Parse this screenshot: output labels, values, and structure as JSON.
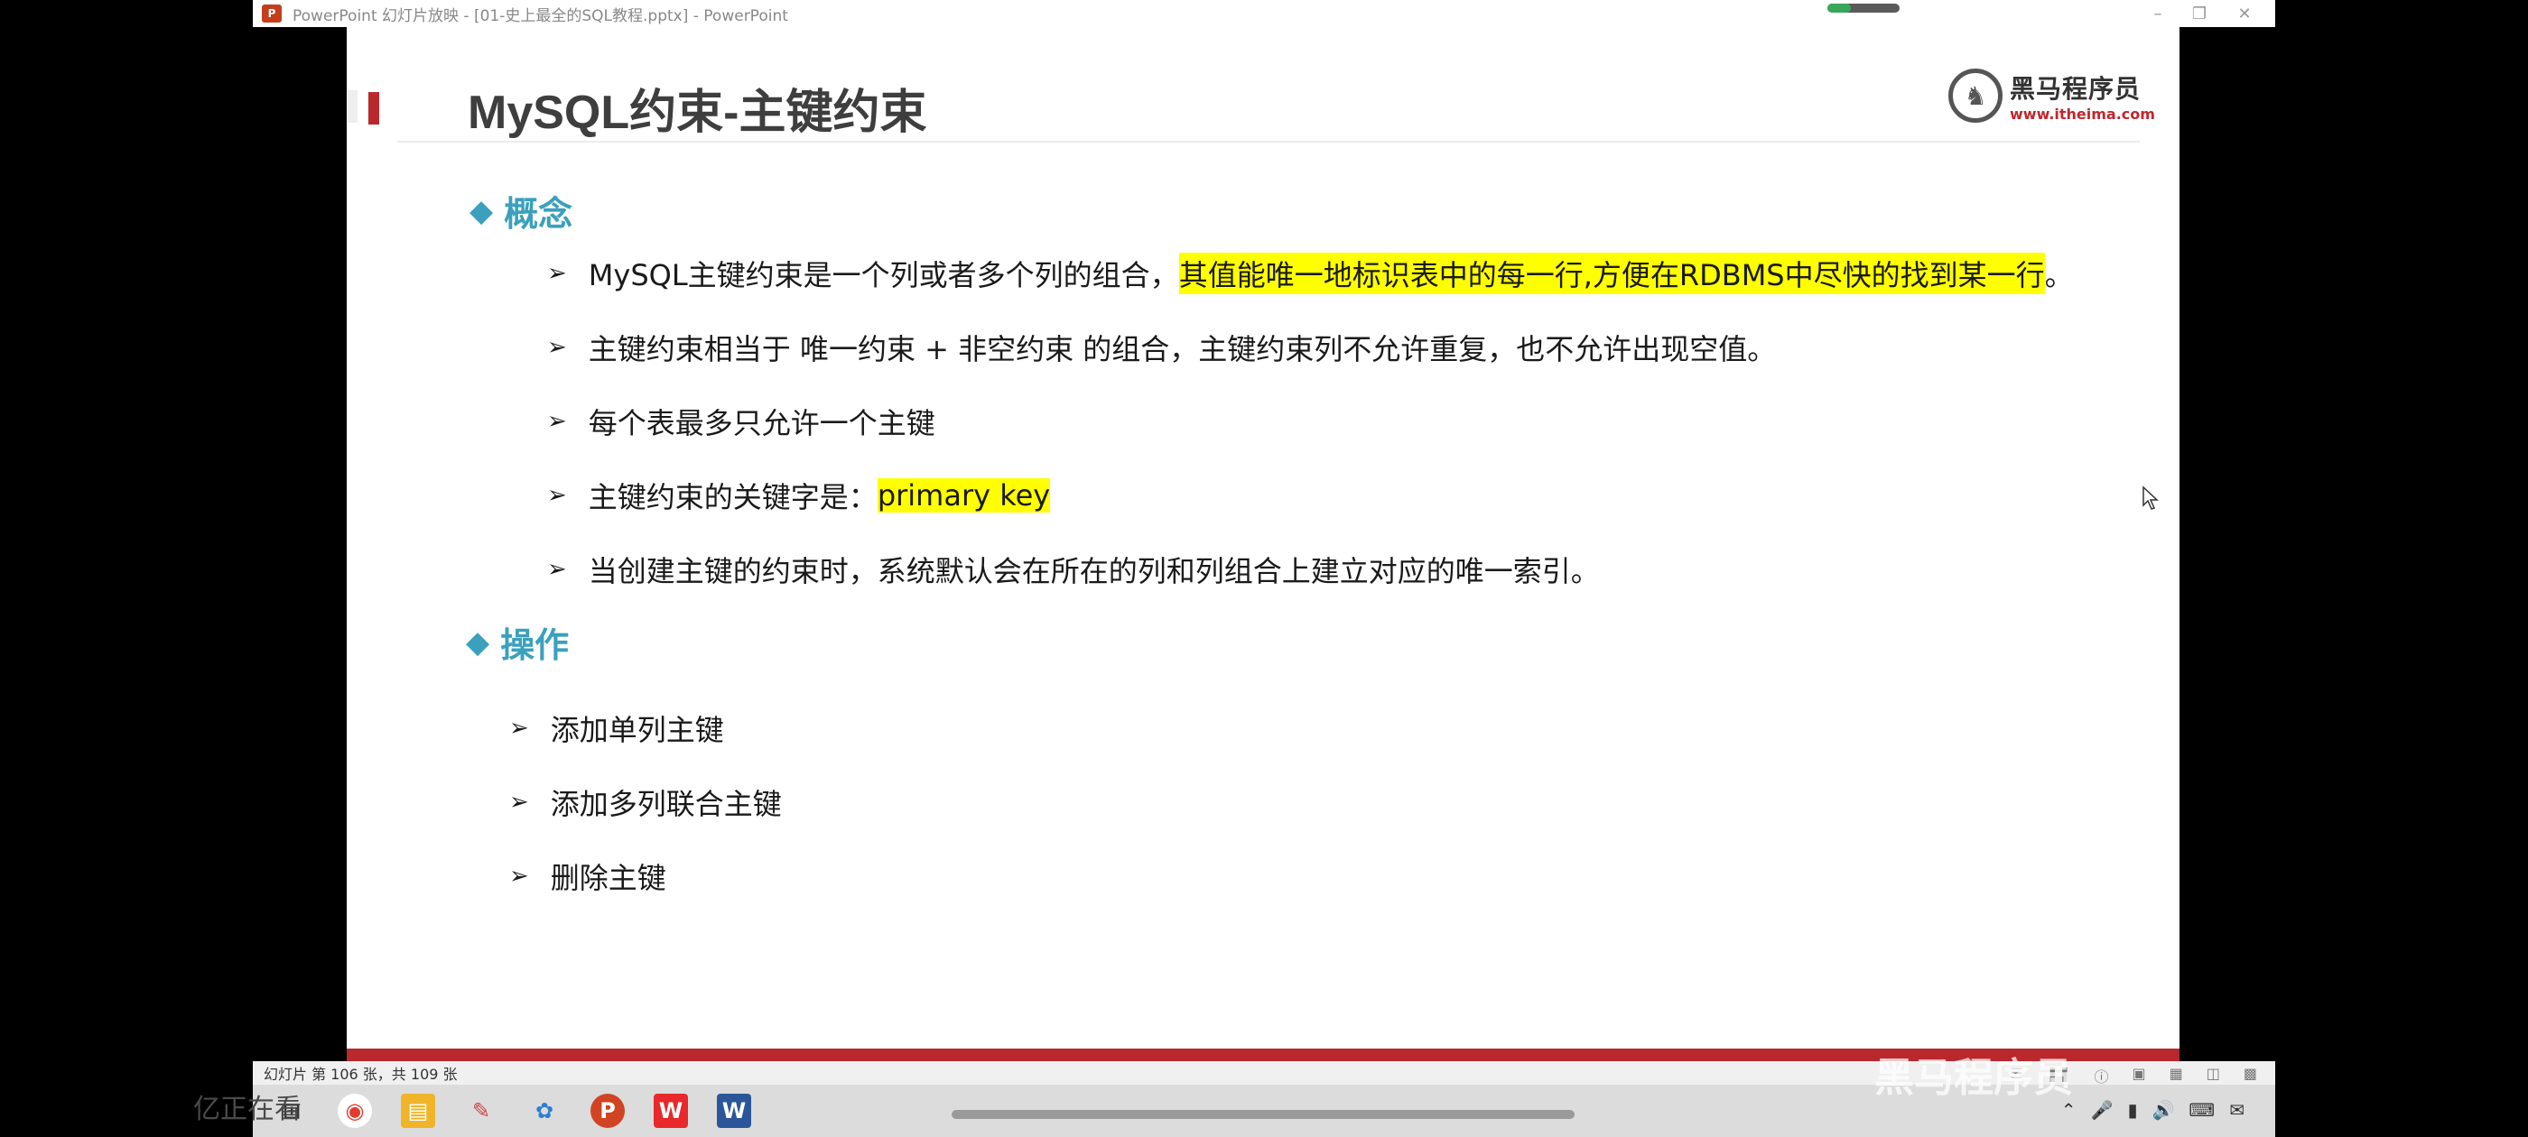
{
  "window": {
    "title": "PowerPoint 幻灯片放映 - [01-史上最全的SQL教程.pptx] - PowerPoint",
    "app_icon": "powerpoint-icon",
    "controls": [
      "minimize-icon",
      "restore-icon",
      "close-icon"
    ]
  },
  "slide": {
    "title": "MySQL约束-主键约束",
    "logo": {
      "name": "黑马程序员",
      "url": "www.itheima.com"
    },
    "sections": [
      {
        "heading": "概念",
        "bullets": [
          {
            "text_a": "MySQL主键约束是一个列或者多个列的组合，",
            "highlight": "其值能唯一地标识表中的每一行,方便在RDBMS中尽快的找到某一行",
            "text_b": "。"
          },
          {
            "text_a": "主键约束相当于 唯一约束 + 非空约束 的组合，主键约束列不允许重复，也不允许出现空值。"
          },
          {
            "text_a": "每个表最多只允许一个主键"
          },
          {
            "text_a": "主键约束的关键字是：",
            "highlight": "primary key"
          },
          {
            "text_a": "当创建主键的约束时，系统默认会在所在的列和列组合上建立对应的唯一索引。"
          }
        ]
      },
      {
        "heading": "操作",
        "bullets": [
          {
            "text_a": "添加单列主键"
          },
          {
            "text_a": "添加多列联合主键"
          },
          {
            "text_a": "删除主键"
          }
        ]
      }
    ],
    "highlight_color": "#ffff00",
    "accent_color": "#3aa0bd",
    "brand_red": "#b8282c"
  },
  "statusbar": {
    "slide_counter": "幻灯片 第 106 张，共 109 张"
  },
  "taskbar": {
    "apps": [
      "windows-start-icon",
      "chrome-icon",
      "file-explorer-icon",
      "pen-app-icon",
      "browser-icon",
      "powerpoint-icon",
      "wps-icon",
      "word-icon"
    ]
  },
  "overlay": {
    "left_text": "亿正在看",
    "watermark": "黑马程序员"
  }
}
